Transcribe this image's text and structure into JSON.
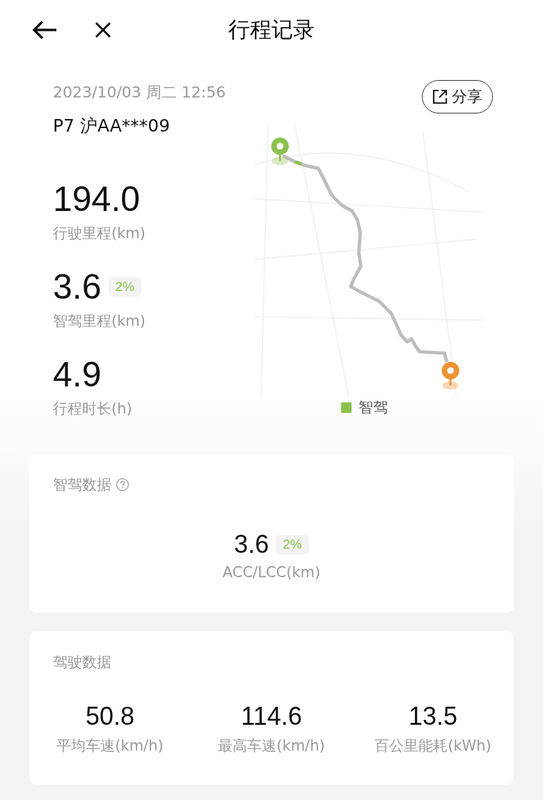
{
  "header": {
    "title": "行程记录"
  },
  "trip": {
    "datetime": "2023/10/03 周二 12:56",
    "vehicle": "P7 沪AA***09",
    "share": "分享"
  },
  "stats": [
    {
      "value": "194.0",
      "label": "行驶里程(km)"
    },
    {
      "value": "3.6",
      "badge": "2%",
      "label": "智驾里程(km)"
    },
    {
      "value": "4.9",
      "label": "行程时长(h)"
    }
  ],
  "legend": [
    {
      "label": "智驾",
      "color": "#8bc34a"
    }
  ],
  "assist_card": {
    "title": "智驾数据",
    "value": "3.6",
    "badge": "2%",
    "label": "ACC/LCC(km)"
  },
  "driving_card": {
    "title": "驾驶数据",
    "metrics": [
      {
        "value": "50.8",
        "label": "平均车速(km/h)"
      },
      {
        "value": "114.6",
        "label": "最高车速(km/h)"
      },
      {
        "value": "13.5",
        "label": "百公里能耗(kWh)"
      }
    ]
  }
}
